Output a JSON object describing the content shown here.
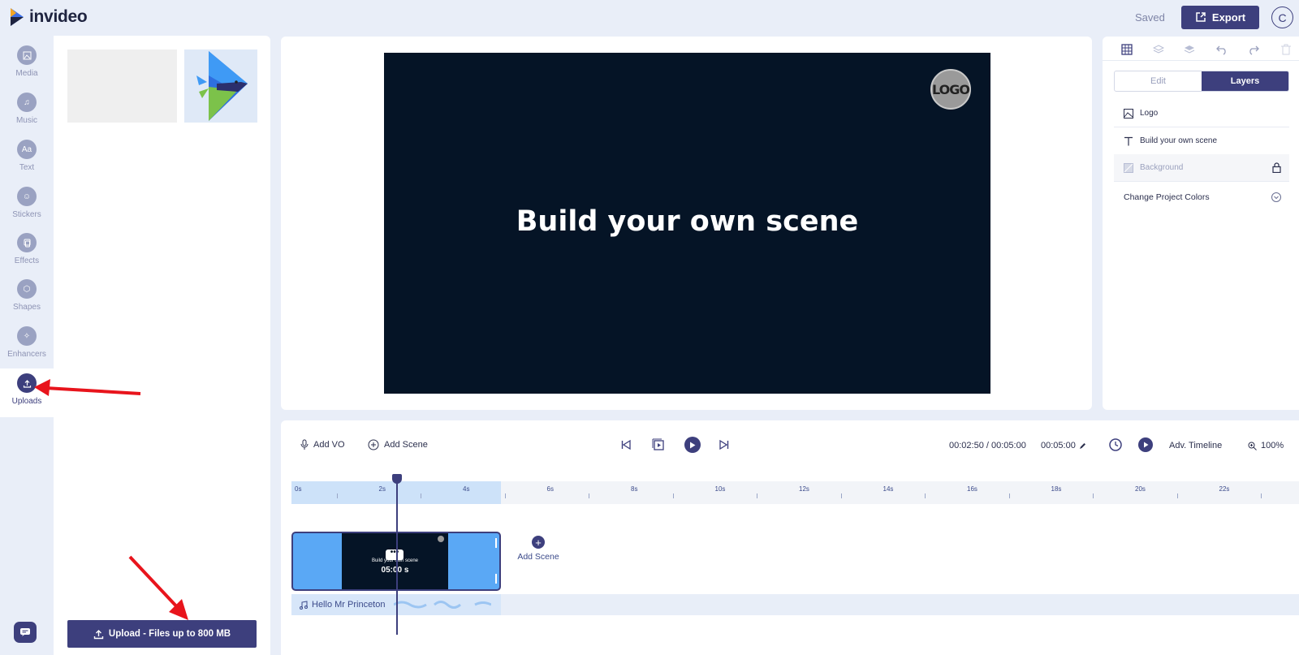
{
  "app": {
    "name": "invideo"
  },
  "header": {
    "saved_label": "Saved",
    "export_label": "Export",
    "avatar_initial": "C"
  },
  "rail": {
    "items": [
      {
        "label": "Media",
        "icon": "image-icon"
      },
      {
        "label": "Music",
        "icon": "music-icon"
      },
      {
        "label": "Text",
        "icon": "text-icon"
      },
      {
        "label": "Stickers",
        "icon": "sticker-icon"
      },
      {
        "label": "Effects",
        "icon": "effects-icon"
      },
      {
        "label": "Shapes",
        "icon": "shapes-icon"
      },
      {
        "label": "Enhancers",
        "icon": "enhancers-icon"
      }
    ],
    "active": {
      "label": "Uploads",
      "icon": "upload-icon"
    },
    "text_icon_glyph": "Aa"
  },
  "uploads_panel": {
    "upload_button_label": "Upload - Files up to 800 MB"
  },
  "scene": {
    "title": "Build your own scene",
    "logo_text": "LOGO",
    "background": "#051426"
  },
  "right_panel": {
    "tabs": [
      {
        "label": "Edit",
        "active": false
      },
      {
        "label": "Layers",
        "active": true
      }
    ],
    "layers": [
      {
        "label": "Logo",
        "icon": "image-icon"
      },
      {
        "label": "Build your own scene",
        "icon": "text-icon"
      },
      {
        "label": "Background",
        "icon": "background-icon",
        "locked": true
      }
    ],
    "colors_label": "Change Project Colors"
  },
  "timeline": {
    "add_vo_label": "Add VO",
    "add_scene_label": "Add Scene",
    "time_current": "00:02:50 / 00:05:00",
    "duration": "00:05:00",
    "adv_label": "Adv. Timeline",
    "zoom": "100%",
    "ticks": [
      "0s",
      "2s",
      "4s",
      "6s",
      "8s",
      "10s",
      "12s",
      "14s",
      "16s",
      "18s",
      "20s",
      "22s"
    ],
    "clip": {
      "text": "Build your own scene",
      "duration": "05:00 s",
      "more": "•••"
    },
    "add_scene_button_label": "Add Scene",
    "audio_track": "Hello Mr Princeton"
  },
  "colors": {
    "accent": "#3d3f7d",
    "clip": "#5aa8f5",
    "annotation_arrow": "#e8141c"
  }
}
